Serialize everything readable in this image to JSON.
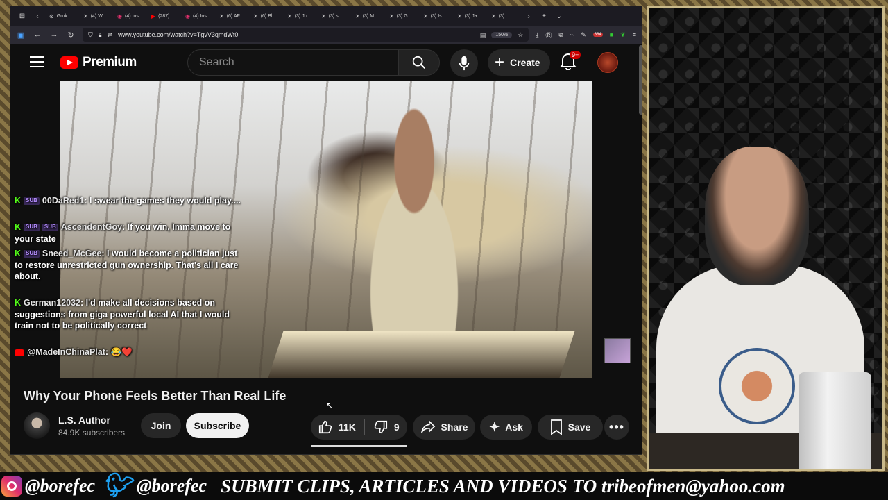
{
  "browser": {
    "tabs": [
      "Grok",
      "(4) W",
      "(4) Ins",
      "(287)",
      "(4) Ins",
      "(6) AF",
      "(6) Bl",
      "(3) Jo",
      "(3) sl",
      "(3) M",
      "(3) G",
      "(3) Is",
      "(3) Ja",
      "(3)"
    ],
    "url": "www.youtube.com/watch?v=TgvV3qmdWt0",
    "zoom": "150%",
    "ext_badge": "384"
  },
  "youtube": {
    "logo_text": "Premium",
    "search_placeholder": "Search",
    "create_label": "Create",
    "notifications_badge": "9+",
    "video_title": "Why Your Phone Feels Better Than Real Life",
    "channel_name": "L.S. Author",
    "subscriber_count": "84.9K subscribers",
    "join_label": "Join",
    "subscribe_label": "Subscribe",
    "likes": "11K",
    "dislikes": "9",
    "share_label": "Share",
    "ask_label": "Ask",
    "save_label": "Save"
  },
  "chat": [
    {
      "user": "00DaRed1",
      "badges": [
        "SUB"
      ],
      "text": ": I swear the games they would play...."
    },
    {
      "user": "AscendentGoy",
      "badges": [
        "SUB",
        "SUB"
      ],
      "text": ": If you win, Imma move to your state"
    },
    {
      "user": "Sneed_McGee",
      "badges": [
        "SUB"
      ],
      "text": ": I would become a politician just to restore unrestricted gun ownership. That's all I care about."
    },
    {
      "user": "German12032",
      "badges": [],
      "text": ": I'd make all decisions based on suggestions from giga powerful local AI that I would train not to be politically correct"
    },
    {
      "user": "@MadeInChinaPlat",
      "badges": [],
      "text": ": 😂❤️"
    }
  ],
  "banner": {
    "instagram_handle": "@borefec",
    "twitter_handle": "@borefec",
    "message": "SUBMIT CLIPS, ARTICLES AND VIDEOS TO tribeofmen@yahoo.com"
  },
  "colors": {
    "yt_red": "#ff0000",
    "kick_green": "#53fc18",
    "sub_purple": "#b48cff"
  }
}
